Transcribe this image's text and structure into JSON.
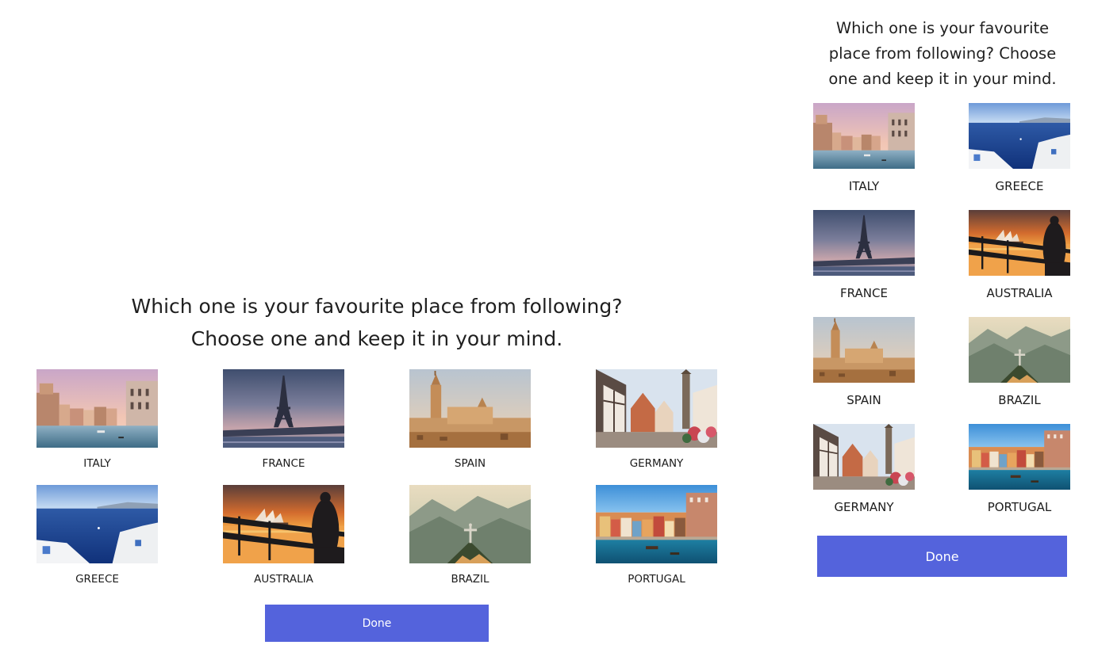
{
  "question": "Which one is your favourite place from following? Choose one and keep it in your mind.",
  "desktop": {
    "question_lines": [
      "Which one is your favourite place from following?",
      "Choose one and keep it in your mind."
    ],
    "grid_order": [
      "italy",
      "france",
      "spain",
      "germany",
      "greece",
      "australia",
      "brazil",
      "portugal"
    ]
  },
  "mobile": {
    "question_lines": [
      "Which one is your favourite",
      "place from following? Choose",
      "one and keep it in your mind."
    ],
    "grid_order": [
      "italy",
      "greece",
      "france",
      "australia",
      "spain",
      "brazil",
      "germany",
      "portugal"
    ]
  },
  "places": {
    "italy": {
      "label": "ITALY",
      "image": "venice-canal-photo"
    },
    "france": {
      "label": "FRANCE",
      "image": "eiffel-tower-photo"
    },
    "spain": {
      "label": "SPAIN",
      "image": "seville-cathedral-photo"
    },
    "germany": {
      "label": "GERMANY",
      "image": "german-old-town-photo"
    },
    "greece": {
      "label": "GREECE",
      "image": "santorini-sea-photo"
    },
    "australia": {
      "label": "AUSTRALIA",
      "image": "sydney-opera-house-sunset-photo"
    },
    "brazil": {
      "label": "BRAZIL",
      "image": "christ-the-redeemer-photo"
    },
    "portugal": {
      "label": "PORTUGAL",
      "image": "porto-riverside-photo"
    }
  },
  "done_label": "Done",
  "colors": {
    "button": "#5463dc",
    "button_text": "#ffffff",
    "text": "#1f1f1f",
    "background": "#ffffff"
  }
}
